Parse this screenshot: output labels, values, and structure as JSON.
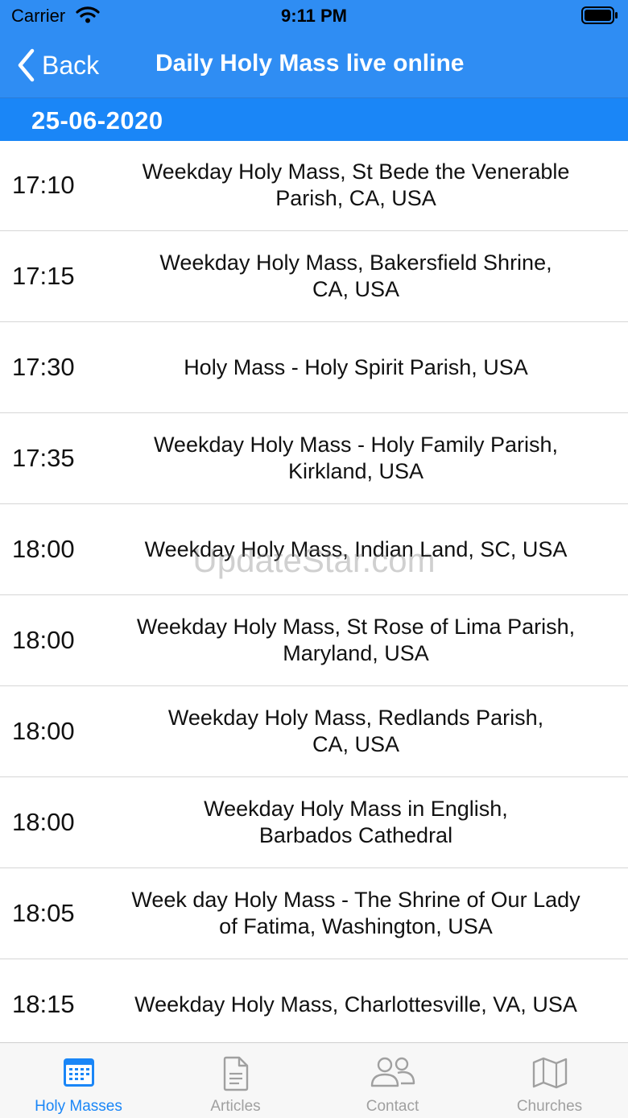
{
  "status_bar": {
    "carrier": "Carrier",
    "time": "9:11 PM"
  },
  "nav": {
    "back_label": "Back",
    "title": "Daily Holy Mass live online"
  },
  "date": "25-06-2020",
  "masses": [
    {
      "time": "17:10",
      "line1": "Weekday Holy Mass, St Bede the Venerable",
      "line2": "Parish, CA, USA"
    },
    {
      "time": "17:15",
      "line1": "Weekday Holy Mass, Bakersfield Shrine,",
      "line2": "CA, USA"
    },
    {
      "time": "17:30",
      "line1": "Holy Mass - Holy Spirit Parish, USA",
      "line2": ""
    },
    {
      "time": "17:35",
      "line1": "Weekday Holy Mass - Holy Family Parish,",
      "line2": "Kirkland, USA"
    },
    {
      "time": "18:00",
      "line1": "Weekday Holy Mass, Indian Land, SC, USA",
      "line2": ""
    },
    {
      "time": "18:00",
      "line1": "Weekday Holy Mass, St Rose of Lima Parish,",
      "line2": "Maryland, USA"
    },
    {
      "time": "18:00",
      "line1": "Weekday Holy Mass, Redlands Parish,",
      "line2": "CA, USA"
    },
    {
      "time": "18:00",
      "line1": "Weekday Holy Mass in English,",
      "line2": "Barbados Cathedral"
    },
    {
      "time": "18:05",
      "line1": "Week day Holy Mass - The Shrine of Our Lady",
      "line2": "of Fatima, Washington, USA"
    },
    {
      "time": "18:15",
      "line1": "Weekday Holy Mass, Charlottesville, VA, USA",
      "line2": ""
    }
  ],
  "watermark": "UpdateStar.com",
  "tabs": [
    {
      "label": "Holy Masses",
      "icon": "calendar-icon",
      "active": true
    },
    {
      "label": "Articles",
      "icon": "document-icon",
      "active": false
    },
    {
      "label": "Contact",
      "icon": "people-icon",
      "active": false
    },
    {
      "label": "Churches",
      "icon": "map-icon",
      "active": false
    }
  ],
  "colors": {
    "accent": "#2f8df3",
    "date_bar": "#1a86f7",
    "tab_active": "#1a86f7",
    "tab_inactive": "#a0a0a0"
  }
}
